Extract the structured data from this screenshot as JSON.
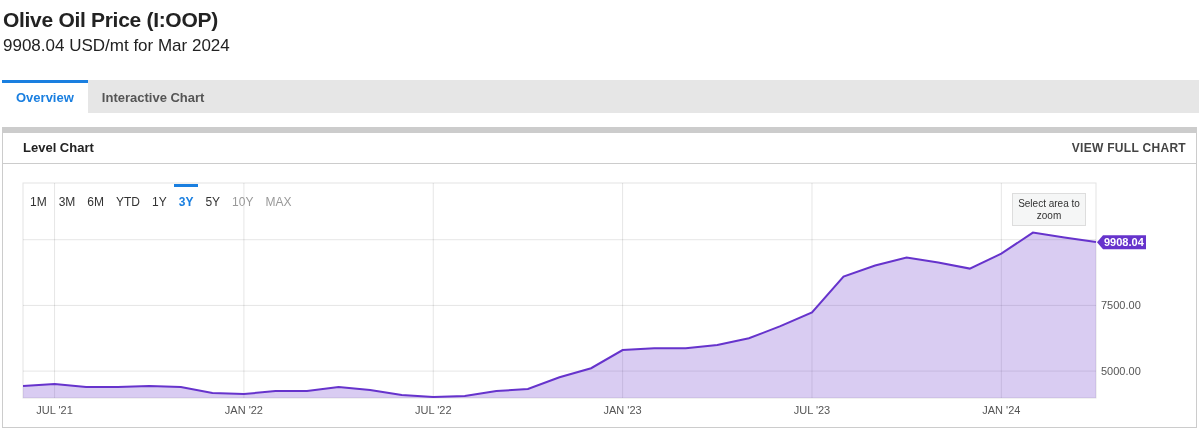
{
  "title": "Olive Oil Price (I:OOP)",
  "subtitle": "9908.04 USD/mt for Mar 2024",
  "tabs": [
    {
      "label": "Overview",
      "selected": true
    },
    {
      "label": "Interactive Chart",
      "selected": false
    }
  ],
  "panel": {
    "title": "Level Chart",
    "link": "VIEW FULL CHART",
    "ranges": [
      {
        "label": "1M",
        "selected": false,
        "disabled": false
      },
      {
        "label": "3M",
        "selected": false,
        "disabled": false
      },
      {
        "label": "6M",
        "selected": false,
        "disabled": false
      },
      {
        "label": "YTD",
        "selected": false,
        "disabled": false
      },
      {
        "label": "1Y",
        "selected": false,
        "disabled": false
      },
      {
        "label": "3Y",
        "selected": true,
        "disabled": false
      },
      {
        "label": "5Y",
        "selected": false,
        "disabled": false
      },
      {
        "label": "10Y",
        "selected": false,
        "disabled": true
      },
      {
        "label": "MAX",
        "selected": false,
        "disabled": true
      }
    ],
    "zoom_button": "Select area to zoom",
    "chart_data": {
      "type": "area",
      "categories": [
        null,
        "JUL '21",
        null,
        null,
        null,
        null,
        null,
        "JAN '22",
        null,
        null,
        null,
        null,
        null,
        "JUL '22",
        null,
        null,
        null,
        null,
        null,
        "JAN '23",
        null,
        null,
        null,
        null,
        null,
        "JUL '23",
        null,
        null,
        null,
        null,
        null,
        "JAN '24",
        null,
        null,
        null
      ],
      "series": [
        {
          "color": "#6633cc",
          "values": [
            4430,
            4510,
            4390,
            4390,
            4430,
            4390,
            4170,
            4130,
            4240,
            4240,
            4390,
            4280,
            4090,
            4020,
            4050,
            4240,
            4320,
            4770,
            5110,
            5800,
            5870,
            5870,
            5990,
            6250,
            6710,
            7240,
            8600,
            9020,
            9320,
            9130,
            8900,
            9470,
            10270,
            10080,
            9908.04
          ]
        }
      ],
      "ylim": [
        3977,
        12159
      ],
      "yticks": [
        {
          "value": 5000,
          "label": "5000.00"
        },
        {
          "value": 7500,
          "label": "7500.00"
        }
      ],
      "grid": true,
      "annotations": [
        "9908.04"
      ]
    }
  }
}
